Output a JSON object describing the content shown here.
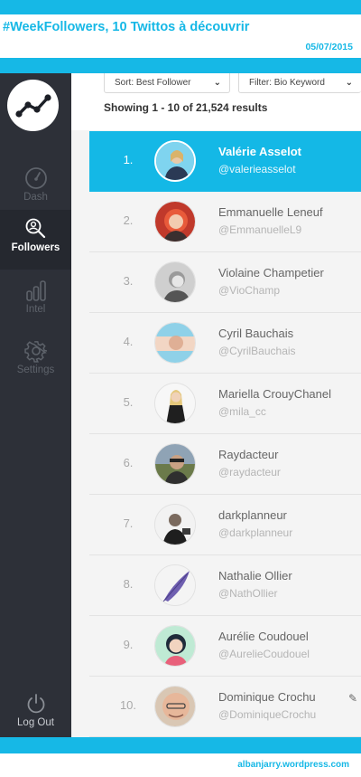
{
  "banner": {
    "title": "#WeekFollowers, 10 Twittos à découvrir",
    "date": "05/07/2015"
  },
  "colors": {
    "accent": "#16b8e6",
    "sidebar": "#2d3038",
    "sidebar_active": "#25282f"
  },
  "sidebar": {
    "logo_icon": "trend-line-icon",
    "items": [
      {
        "label": "Dash",
        "icon": "gauge-icon"
      },
      {
        "label": "Followers",
        "icon": "magnifier-people-icon"
      },
      {
        "label": "Intel",
        "icon": "bar-chart-icon"
      },
      {
        "label": "Settings",
        "icon": "gear-icon"
      }
    ],
    "logout": {
      "label": "Log Out",
      "icon": "power-icon"
    }
  },
  "controls": {
    "sort": {
      "label": "Sort: Best Follower",
      "icon": "chevron-down-icon"
    },
    "filter": {
      "label": "Filter: Bio Keyword",
      "icon": "chevron-down-icon"
    },
    "results": "Showing 1 - 10 of 21,524 results"
  },
  "followers": [
    {
      "rank": "1.",
      "name": "Valérie Asselot",
      "handle": "@valerieasselot",
      "selected": true
    },
    {
      "rank": "2.",
      "name": "Emmanuelle Leneuf",
      "handle": "@EmmanuelleL9"
    },
    {
      "rank": "3.",
      "name": "Violaine Champetier",
      "handle": "@VioChamp"
    },
    {
      "rank": "4.",
      "name": "Cyril Bauchais",
      "handle": "@CyrilBauchais"
    },
    {
      "rank": "5.",
      "name": "Mariella CrouyChanel",
      "handle": "@mila_cc"
    },
    {
      "rank": "6.",
      "name": "Raydacteur",
      "handle": "@raydacteur"
    },
    {
      "rank": "7.",
      "name": "darkplanneur",
      "handle": "@darkplanneur"
    },
    {
      "rank": "8.",
      "name": "Nathalie Ollier",
      "handle": "@NathOllier"
    },
    {
      "rank": "9.",
      "name": "Aurélie Coudouel",
      "handle": "@AurelieCoudouel"
    },
    {
      "rank": "10.",
      "name": "Dominique Crochu",
      "handle": "@DominiqueCrochu",
      "badge_icon": "pen-icon"
    }
  ],
  "footer": {
    "credit": "albanjarry.wordpress.com"
  }
}
